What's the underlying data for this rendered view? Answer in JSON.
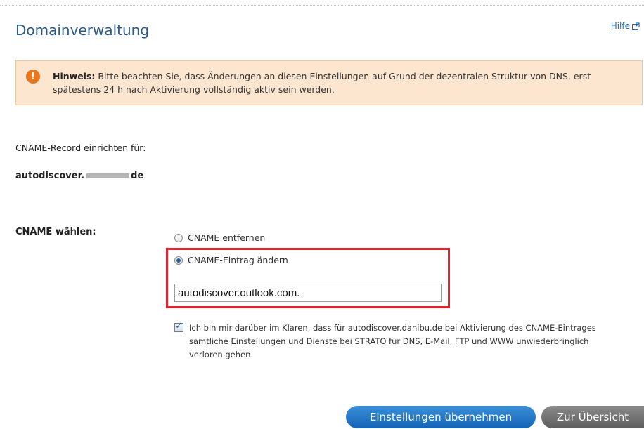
{
  "header": {
    "title": "Domainverwaltung",
    "help_label": "Hilfe"
  },
  "notice": {
    "icon": "exclamation-icon",
    "label": "Hinweis:",
    "text": " Bitte beachten Sie, dass Änderungen an diesen Einstellungen auf Grund der dezentralen Struktur von DNS, erst spätestens 24 h nach Aktivierung vollständig aktiv sein werden."
  },
  "record": {
    "label": "CNAME-Record einrichten für:",
    "domain_prefix": "autodiscover.",
    "domain_suffix": "de"
  },
  "cname": {
    "label": "CNAME wählen:",
    "options": [
      {
        "label": "CNAME entfernen",
        "selected": false
      },
      {
        "label": "CNAME-Eintrag ändern",
        "selected": true
      }
    ],
    "value": "autodiscover.outlook.com.",
    "confirm_checked": true,
    "confirm_text": "Ich bin mir darüber im Klaren, dass für autodiscover.danibu.de bei Aktivierung des CNAME-Eintrages sämtliche Einstellungen und Dienste bei STRATO für DNS, E-Mail, FTP und WWW unwiederbringlich verloren gehen."
  },
  "buttons": {
    "apply": "Einstellungen übernehmen",
    "overview": "Zur Übersicht"
  },
  "colors": {
    "title": "#2c5a8c",
    "notice_bg": "#fde6cf",
    "notice_icon": "#e8761c",
    "highlight": "#e0242f",
    "primary_button": "#1f72c4",
    "secondary_button": "#707070"
  }
}
